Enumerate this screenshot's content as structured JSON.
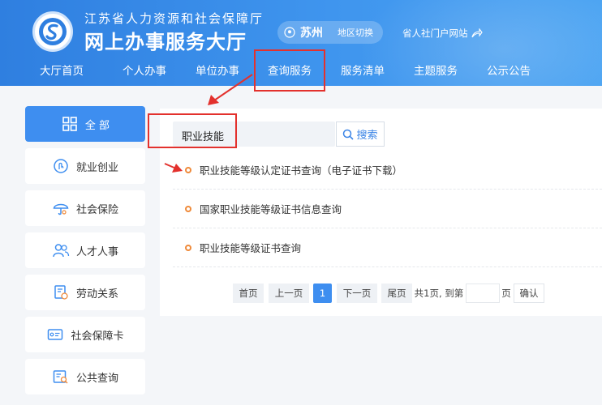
{
  "header": {
    "org": "江苏省人力资源和社会保障厅",
    "title": "网上办事服务大厅",
    "city": "苏州",
    "region_switch": "地区切换",
    "portal_link": "省人社门户网站"
  },
  "nav": {
    "items": [
      "大厅首页",
      "个人办事",
      "单位办事",
      "查询服务",
      "服务清单",
      "主题服务",
      "公示公告"
    ],
    "active_index": 3
  },
  "sidebar": {
    "items": [
      {
        "label": "全 部",
        "icon": "grid-icon"
      },
      {
        "label": "就业创业",
        "icon": "employment-icon"
      },
      {
        "label": "社会保险",
        "icon": "umbrella-icon"
      },
      {
        "label": "人才人事",
        "icon": "people-icon"
      },
      {
        "label": "劳动关系",
        "icon": "contract-icon"
      },
      {
        "label": "社会保障卡",
        "icon": "card-icon"
      },
      {
        "label": "公共查询",
        "icon": "query-icon"
      }
    ],
    "active_index": 0
  },
  "search": {
    "value": "职业技能",
    "button_label": "搜索"
  },
  "results": [
    "职业技能等级认定证书查询（电子证书下载）",
    "国家职业技能等级证书信息查询",
    "职业技能等级证书查询"
  ],
  "pagination": {
    "first": "首页",
    "prev": "上一页",
    "current": "1",
    "next": "下一页",
    "last": "尾页",
    "summary": "共1页, 到第",
    "page_unit": "页",
    "confirm": "确认"
  },
  "colors": {
    "header_blue": "#3a8ceb",
    "active_blue": "#3e8ef0",
    "highlight_red": "#e3312d",
    "bullet_orange": "#ef8a3a"
  }
}
